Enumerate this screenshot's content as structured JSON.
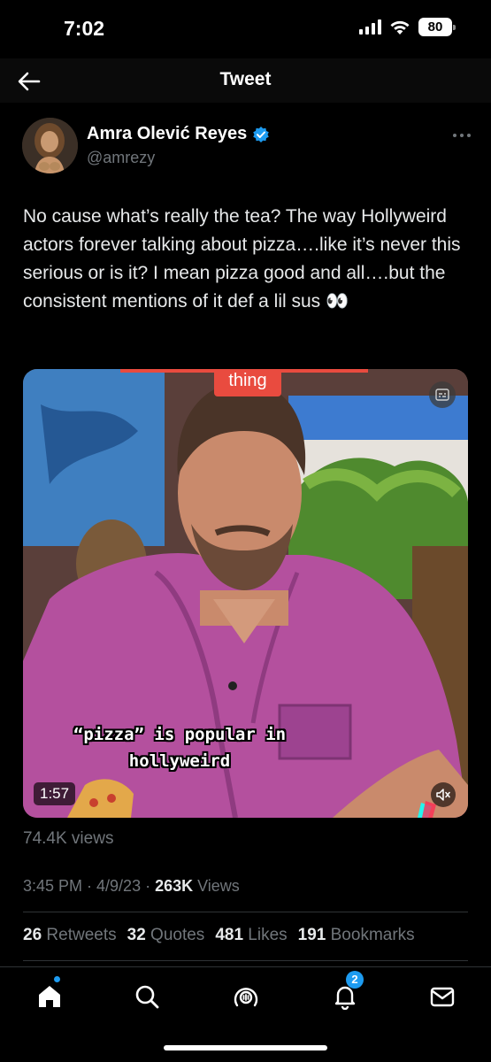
{
  "status_bar": {
    "time": "7:02",
    "battery": "80"
  },
  "nav": {
    "title": "Tweet"
  },
  "tweet": {
    "display_name": "Amra Olević Reyes",
    "handle": "@amrezy",
    "verified": true,
    "text": "No cause what’s really the tea? The way Hollyweird actors forever talking about pizza….like it’s never this serious or is it? I mean pizza good and all….but the consistent mentions of it def a lil sus 👀",
    "media": {
      "caption_top": "thing",
      "caption_line_1": "“pizza” is popular in",
      "caption_line_2": "hollyweird",
      "duration": "1:57"
    },
    "views_label": "74.4K views",
    "timestamp": "3:45 PM · 4/9/23 · ",
    "views_count": "263K",
    "views_word": " Views"
  },
  "stats": {
    "retweets_count": "26",
    "retweets_label": " Retweets",
    "quotes_count": "32",
    "quotes_label": " Quotes",
    "likes_count": "481",
    "likes_label": " Likes",
    "bookmarks_count": "191",
    "bookmarks_label": " Bookmarks"
  },
  "tab_bar": {
    "notifications_badge": "2",
    "accent_color": "#1d9bf0"
  }
}
